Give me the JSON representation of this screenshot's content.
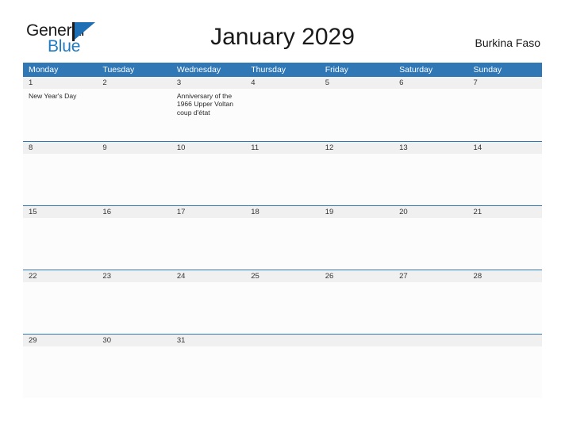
{
  "brand": {
    "name_part1": "General",
    "name_part2": "Blue",
    "flag_icon": "flag-triangle-icon"
  },
  "header": {
    "title": "January 2029",
    "country": "Burkina Faso"
  },
  "colors": {
    "header_band": "#2f77b5",
    "row_divider": "#2f77b5",
    "date_band": "#f0f0f0",
    "cell_background": "#fcfcfc",
    "brand_blue": "#1f7bc1",
    "text": "#222222"
  },
  "calendar": {
    "weekdays": [
      "Monday",
      "Tuesday",
      "Wednesday",
      "Thursday",
      "Friday",
      "Saturday",
      "Sunday"
    ],
    "weeks": [
      [
        {
          "day": "1",
          "events": [
            "New Year's Day"
          ]
        },
        {
          "day": "2",
          "events": []
        },
        {
          "day": "3",
          "events": [
            "Anniversary of the 1966 Upper Voltan coup d'état"
          ]
        },
        {
          "day": "4",
          "events": []
        },
        {
          "day": "5",
          "events": []
        },
        {
          "day": "6",
          "events": []
        },
        {
          "day": "7",
          "events": []
        }
      ],
      [
        {
          "day": "8",
          "events": []
        },
        {
          "day": "9",
          "events": []
        },
        {
          "day": "10",
          "events": []
        },
        {
          "day": "11",
          "events": []
        },
        {
          "day": "12",
          "events": []
        },
        {
          "day": "13",
          "events": []
        },
        {
          "day": "14",
          "events": []
        }
      ],
      [
        {
          "day": "15",
          "events": []
        },
        {
          "day": "16",
          "events": []
        },
        {
          "day": "17",
          "events": []
        },
        {
          "day": "18",
          "events": []
        },
        {
          "day": "19",
          "events": []
        },
        {
          "day": "20",
          "events": []
        },
        {
          "day": "21",
          "events": []
        }
      ],
      [
        {
          "day": "22",
          "events": []
        },
        {
          "day": "23",
          "events": []
        },
        {
          "day": "24",
          "events": []
        },
        {
          "day": "25",
          "events": []
        },
        {
          "day": "26",
          "events": []
        },
        {
          "day": "27",
          "events": []
        },
        {
          "day": "28",
          "events": []
        }
      ],
      [
        {
          "day": "29",
          "events": []
        },
        {
          "day": "30",
          "events": []
        },
        {
          "day": "31",
          "events": []
        },
        {
          "day": "",
          "events": []
        },
        {
          "day": "",
          "events": []
        },
        {
          "day": "",
          "events": []
        },
        {
          "day": "",
          "events": []
        }
      ]
    ]
  }
}
